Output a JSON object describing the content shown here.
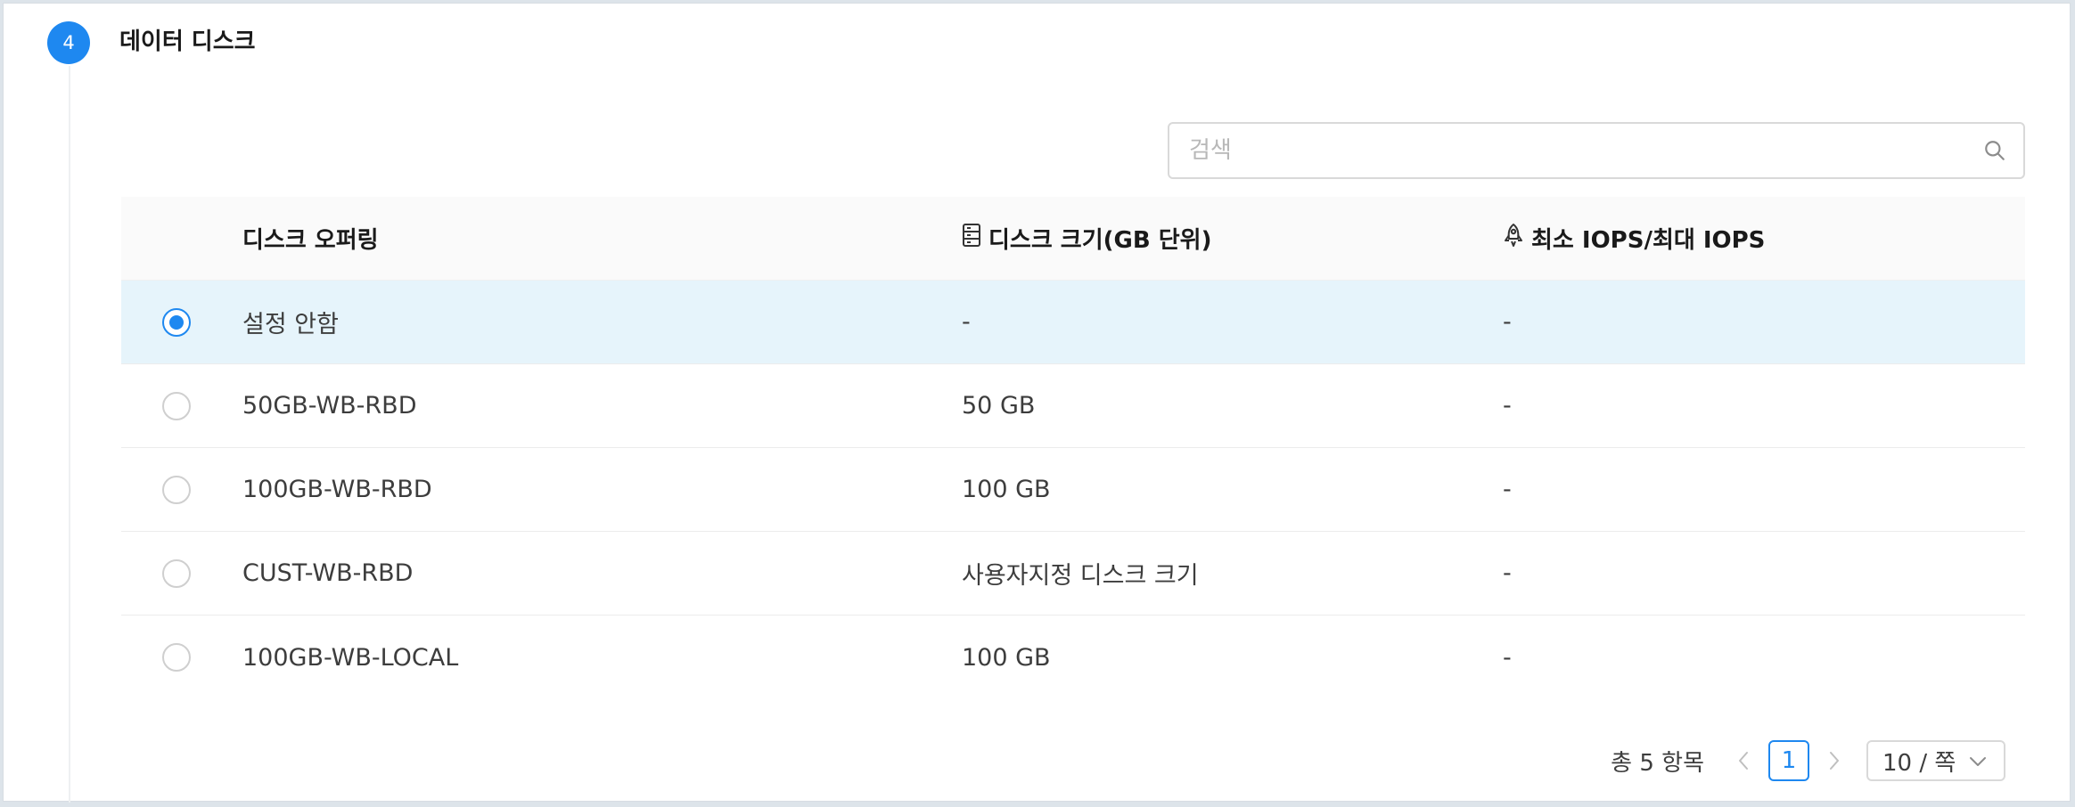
{
  "step": {
    "number": "4",
    "title": "데이터 디스크"
  },
  "search": {
    "placeholder": "검색",
    "value": ""
  },
  "table": {
    "headers": {
      "offering": "디스크 오퍼링",
      "size": "디스크 크기(GB 단위)",
      "iops": "최소 IOPS/최대 IOPS"
    },
    "rows": [
      {
        "offering": "설정 안함",
        "size": "-",
        "iops": "-",
        "selected": true
      },
      {
        "offering": "50GB-WB-RBD",
        "size": "50 GB",
        "iops": "-",
        "selected": false
      },
      {
        "offering": "100GB-WB-RBD",
        "size": "100 GB",
        "iops": "-",
        "selected": false
      },
      {
        "offering": "CUST-WB-RBD",
        "size": "사용자지정 디스크 크기",
        "iops": "-",
        "selected": false
      },
      {
        "offering": "100GB-WB-LOCAL",
        "size": "100 GB",
        "iops": "-",
        "selected": false
      }
    ]
  },
  "pagination": {
    "total_label": "총 5 항목",
    "current_page": "1",
    "page_size": "10 / 쪽"
  },
  "icons": {
    "search": "search-icon",
    "size_header": "hard-drive-icon",
    "iops_header": "rocket-icon",
    "prev": "chevron-left-icon",
    "next": "chevron-right-icon",
    "dropdown": "chevron-down-icon"
  },
  "colors": {
    "accent": "#1e88f0",
    "selected_row": "#e6f4fb",
    "header_bg": "#fafafa"
  }
}
